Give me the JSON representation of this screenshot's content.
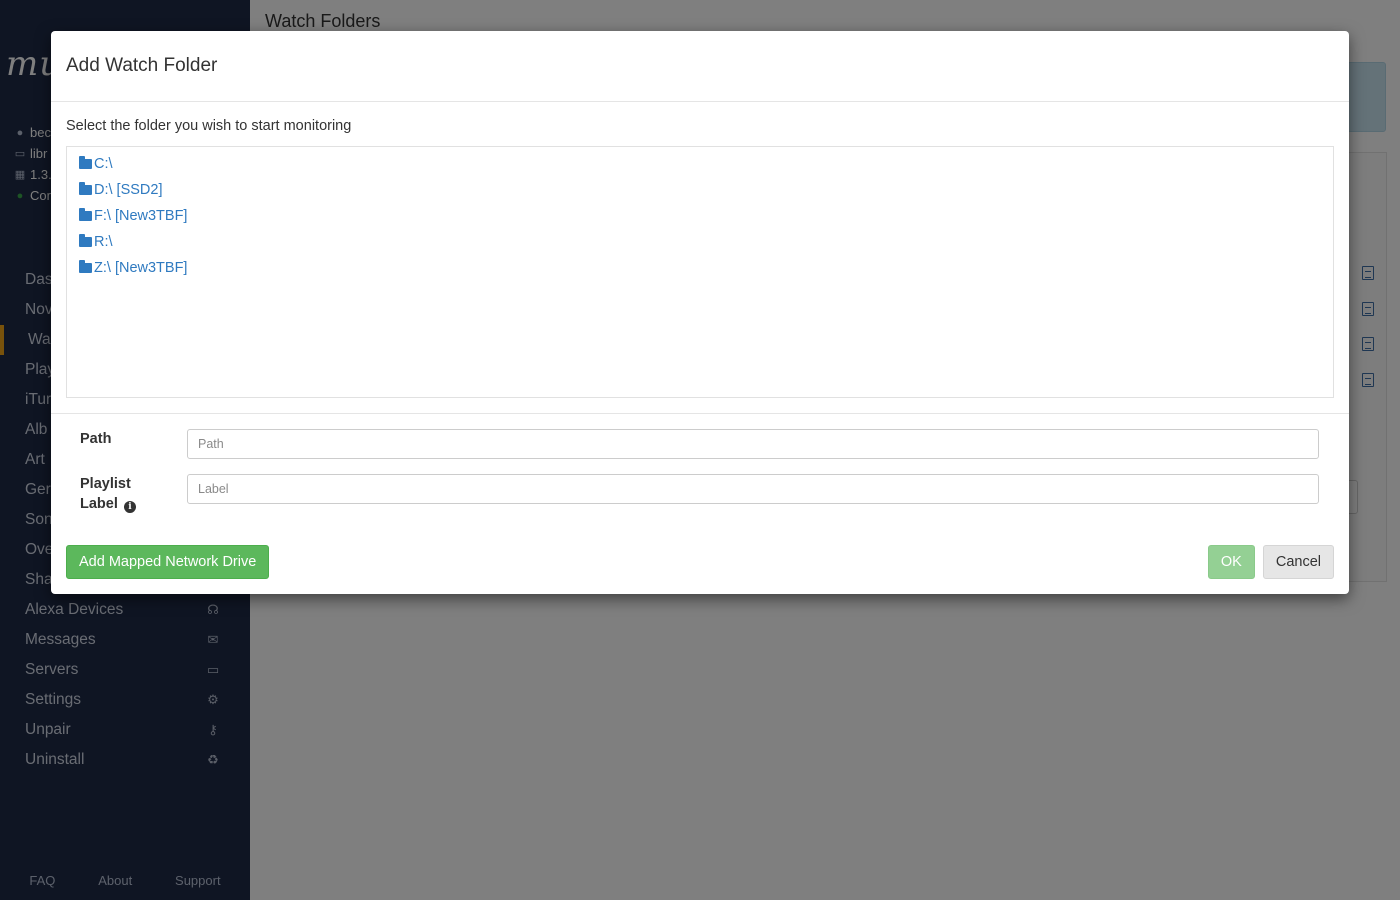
{
  "app": {
    "logo_text": "mu",
    "info_rows": [
      {
        "icon": "user-icon",
        "glyph": "●",
        "text": "bec"
      },
      {
        "icon": "laptop-icon",
        "glyph": "▭",
        "text": "libr"
      },
      {
        "icon": "calendar-icon",
        "glyph": "▦",
        "text": "1.3.1"
      },
      {
        "icon": "connected-dot-icon",
        "glyph": "●",
        "text": "Cor"
      }
    ],
    "nav": [
      {
        "label": "Das",
        "icon": "",
        "active": false
      },
      {
        "label": "Nov",
        "icon": "",
        "active": false
      },
      {
        "label": "Wa",
        "icon": "",
        "active": true
      },
      {
        "label": "Play",
        "icon": "",
        "active": false
      },
      {
        "label": "iTur",
        "icon": "",
        "active": false
      },
      {
        "label": "Alb",
        "icon": "",
        "active": false
      },
      {
        "label": "Art",
        "icon": "",
        "active": false
      },
      {
        "label": "Ger",
        "icon": "",
        "active": false
      },
      {
        "label": "Son",
        "icon": "",
        "active": false
      },
      {
        "label": "Ove",
        "icon": "",
        "active": false
      },
      {
        "label": "Sha",
        "icon": "",
        "active": false
      },
      {
        "label": "Alexa Devices",
        "icon": "☊",
        "active": false
      },
      {
        "label": "Messages",
        "icon": "✉",
        "active": false
      },
      {
        "label": "Servers",
        "icon": "▭",
        "active": false
      },
      {
        "label": "Settings",
        "icon": "⚙",
        "active": false
      },
      {
        "label": "Unpair",
        "icon": "⚷",
        "active": false
      },
      {
        "label": "Uninstall",
        "icon": "♻",
        "active": false
      }
    ],
    "footer": {
      "faq": "FAQ",
      "about": "About",
      "support": "Support"
    },
    "page_title": "Watch Folders"
  },
  "modal": {
    "title": "Add Watch Folder",
    "instructions": "Select the folder you wish to start monitoring",
    "folders": [
      {
        "label": "C:\\"
      },
      {
        "label": "D:\\ [SSD2]"
      },
      {
        "label": "F:\\ [New3TBF]"
      },
      {
        "label": "R:\\"
      },
      {
        "label": "Z:\\ [New3TBF]"
      }
    ],
    "path_label": "Path",
    "path_placeholder": "Path",
    "path_value": "",
    "playlist_label_line1": "Playlist",
    "playlist_label_line2": "Label",
    "label_placeholder": "Label",
    "label_value": "",
    "add_network_drive_label": "Add Mapped Network Drive",
    "ok_label": "OK",
    "cancel_label": "Cancel"
  },
  "colors": {
    "sidebar_bg": "#1e2a47",
    "active_accent": "#f0a417",
    "link_blue": "#2f7ac0",
    "success_green": "#5cb85c"
  }
}
